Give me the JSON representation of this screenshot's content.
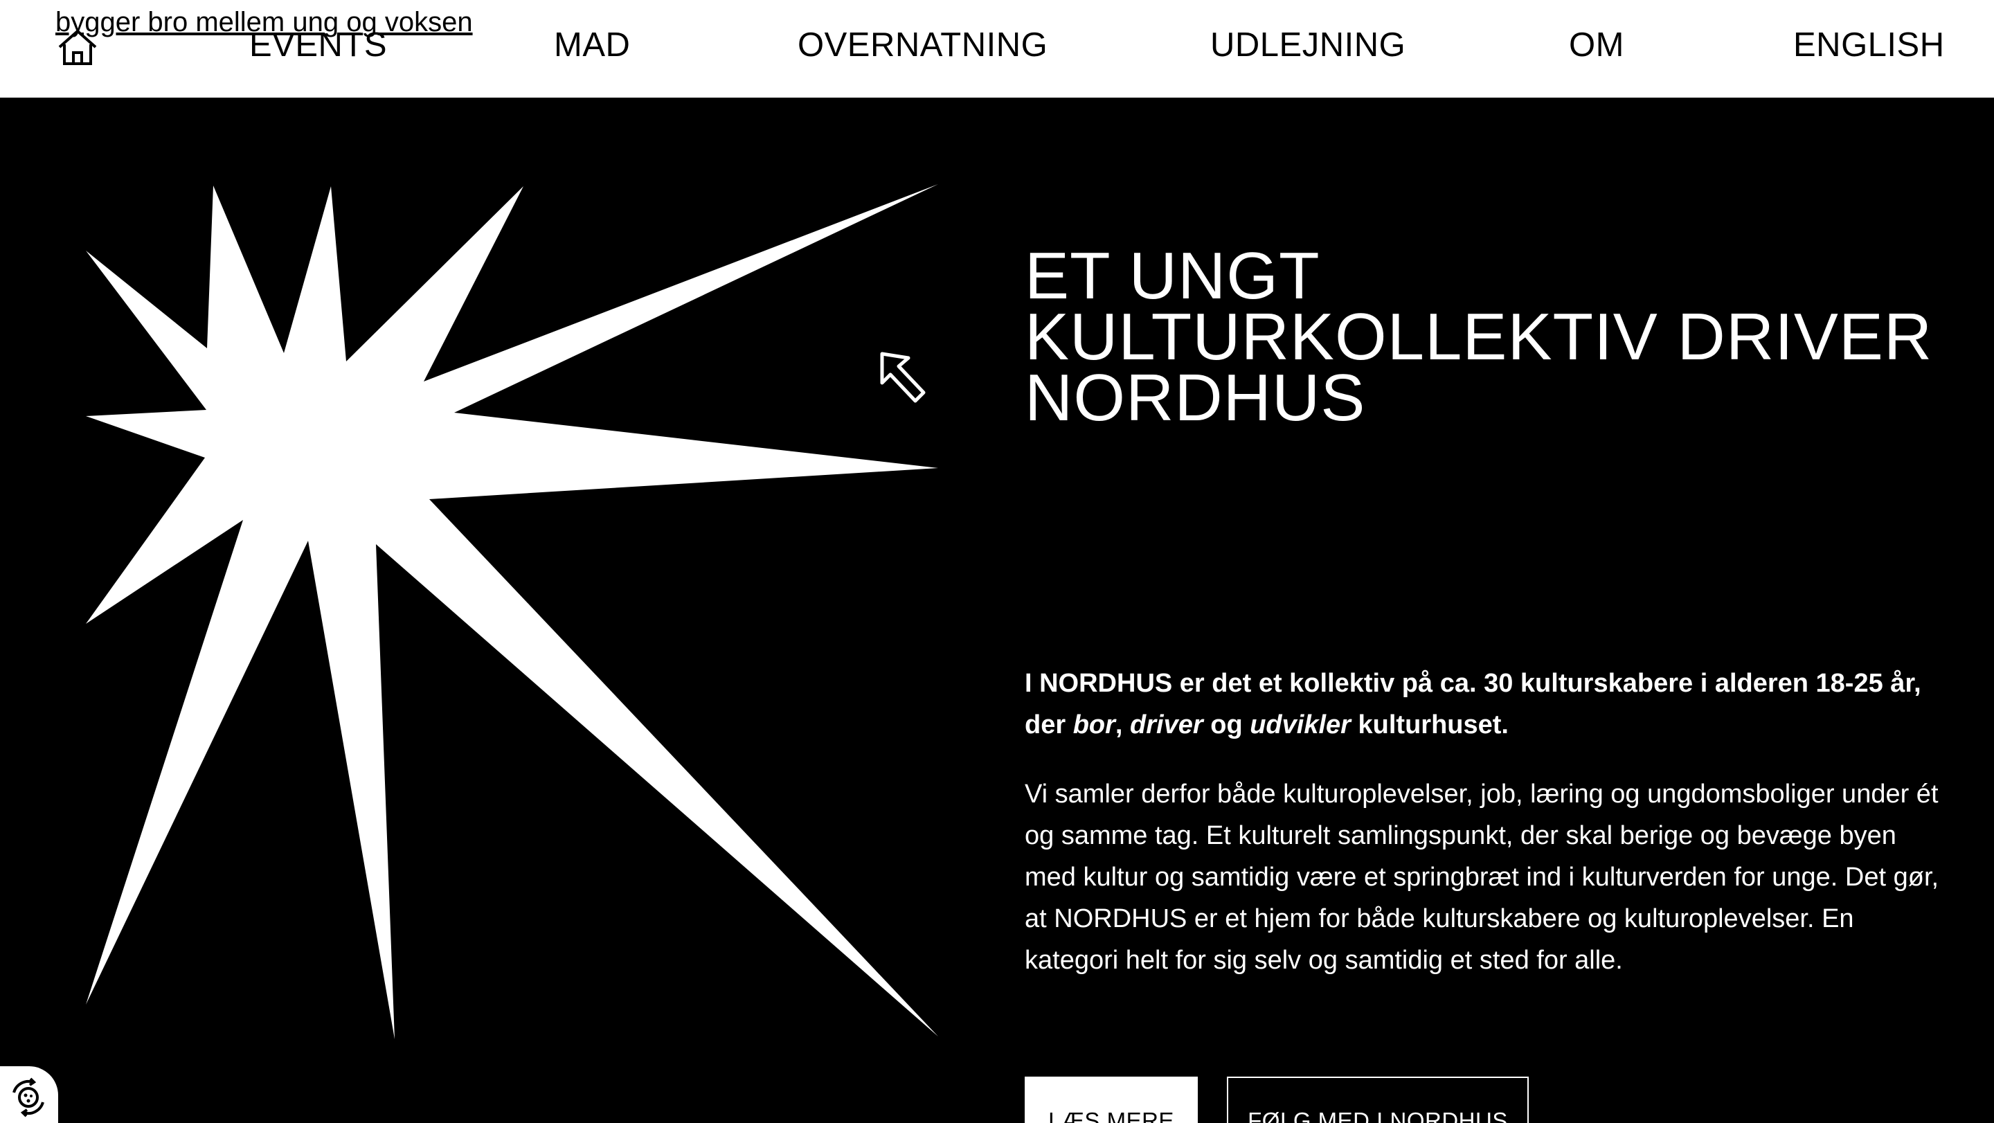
{
  "header": {
    "tagline": "bygger bro mellem ung og voksen",
    "nav": [
      {
        "label": "EVENTS"
      },
      {
        "label": "MAD"
      },
      {
        "label": "OVERNATNING"
      },
      {
        "label": "UDLEJNING"
      },
      {
        "label": "OM"
      },
      {
        "label": "ENGLISH"
      }
    ],
    "home_icon": "home-icon"
  },
  "hero": {
    "title": "ET UNGT\nKULTURKOLLEKTIV DRIVER\nNORDHUS",
    "lead_part1": "I NORDHUS er det et kollektiv på ca. 30 kulturskabere i alderen 18-25 år, der ",
    "lead_bor": "bor",
    "lead_comma": ", ",
    "lead_driver": "driver",
    "lead_og": " og ",
    "lead_udvikler": "udvikler",
    "lead_end": " kulturhuset.",
    "body": "Vi samler derfor både kulturoplevelser, job, læring og ungdomsboliger under ét og samme tag. Et kulturelt samlingspunkt, der skal berige og bevæge byen med kultur og samtidig være et springbræt ind i kulturverden for unge. Det gør, at NORDHUS er et hjem for både kulturskabere og kulturoplevelser. En kategori helt for sig selv og samtidig et sted for alle.",
    "button_primary": "LÆS MERE",
    "button_secondary": "FØLG MED I NORDHUS"
  },
  "colors": {
    "background": "#000000",
    "header_background": "#ffffff",
    "text_light": "#ffffff",
    "text_dark": "#000000"
  },
  "icons": [
    "home-icon",
    "star-graphic",
    "arrow-cursor-icon",
    "cookie-settings-icon"
  ]
}
